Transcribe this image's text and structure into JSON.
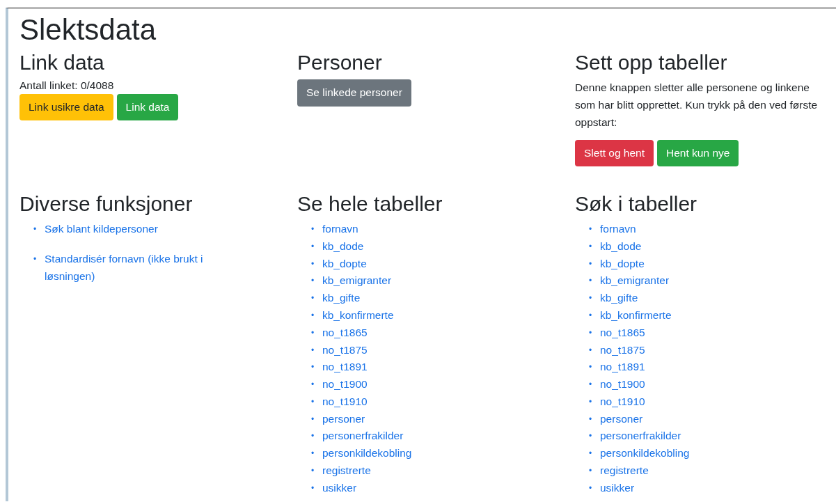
{
  "title": "Slektsdata",
  "sections": [
    {
      "heading": "Link data",
      "text": "Antall linket: 0/4088",
      "buttons": [
        {
          "label": "Link usikre data",
          "kind": "warning"
        },
        {
          "label": "Link data",
          "kind": "success"
        }
      ]
    },
    {
      "heading": "Personer",
      "buttons": [
        {
          "label": "Se linkede personer",
          "kind": "secondary"
        }
      ]
    },
    {
      "heading": "Sett opp tabeller",
      "text": "Denne knappen sletter alle personene og linkene som har blitt opprettet. Kun trykk på den ved første oppstart:",
      "buttons": [
        {
          "label": "Slett og hent",
          "kind": "danger"
        },
        {
          "label": "Hent kun nye",
          "kind": "success"
        }
      ]
    },
    {
      "heading": "Diverse funksjoner",
      "kind": "functions",
      "bullet": "•",
      "links": [
        "Søk blant kildepersoner",
        "Standardisér fornavn (ikke brukt i løsningen)"
      ]
    },
    {
      "heading": "Se hele tabeller",
      "kind": "tables",
      "bullet": "•",
      "links": [
        "fornavn",
        "kb_dode",
        "kb_dopte",
        "kb_emigranter",
        "kb_gifte",
        "kb_konfirmerte",
        "no_t1865",
        "no_t1875",
        "no_t1891",
        "no_t1900",
        "no_t1910",
        "personer",
        "personerfrakilder",
        "personkildekobling",
        "registrerte",
        "usikker"
      ]
    },
    {
      "heading": "Søk i tabeller",
      "kind": "tables",
      "bullet": "•",
      "links": [
        "fornavn",
        "kb_dode",
        "kb_dopte",
        "kb_emigranter",
        "kb_gifte",
        "kb_konfirmerte",
        "no_t1865",
        "no_t1875",
        "no_t1891",
        "no_t1900",
        "no_t1910",
        "personer",
        "personerfrakilder",
        "personkildekobling",
        "registrerte",
        "usikker"
      ]
    }
  ]
}
